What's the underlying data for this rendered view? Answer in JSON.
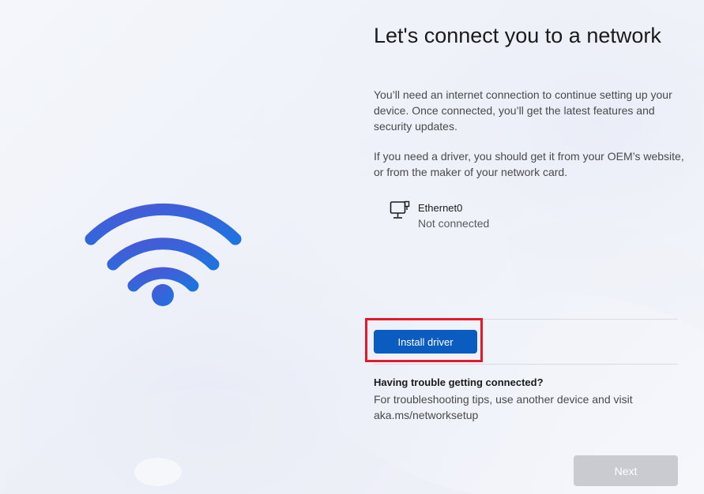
{
  "colors": {
    "accent": "#0b5cc1",
    "highlight": "#e21b2b",
    "disabled_button": "#c9cbd0",
    "wifi_gradient_start": "#4a58d6",
    "wifi_gradient_end": "#1f73e0"
  },
  "illustration": {
    "icon": "wifi-icon"
  },
  "main": {
    "title": "Let's connect you to a network",
    "description": "You’ll need an internet connection to continue setting up your device. Once connected, you’ll get the latest features and security updates.",
    "driver_note": "If you need a driver, you should get it from your OEM’s website, or from the maker of your network card."
  },
  "network": {
    "adapters": [
      {
        "icon": "ethernet-icon",
        "name": "Ethernet0",
        "status": "Not connected"
      }
    ]
  },
  "actions": {
    "install_driver_label": "Install driver",
    "next_label": "Next"
  },
  "help": {
    "title": "Having trouble getting connected?",
    "text": "For troubleshooting tips, use another device and visit aka.ms/networksetup"
  }
}
